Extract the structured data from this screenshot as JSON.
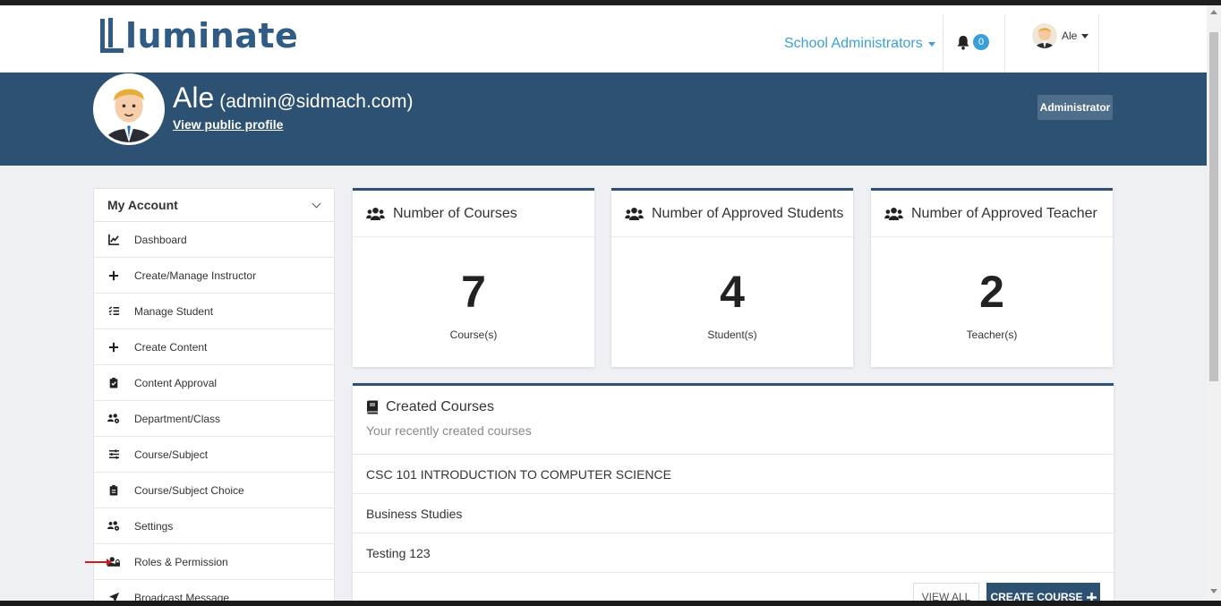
{
  "brand": {
    "name": "luminate"
  },
  "navbar": {
    "role_menu_label": "School Administrators",
    "notification_count": "0",
    "user_name": "Ale"
  },
  "profile": {
    "name": "Ale",
    "email": "(admin@sidmach.com)",
    "public_profile_link": "View public profile",
    "role_badge": "Administrator"
  },
  "sidebar": {
    "title": "My Account",
    "items": [
      {
        "label": "Dashboard",
        "icon": "chart-line-icon"
      },
      {
        "label": "Create/Manage Instructor",
        "icon": "plus-icon"
      },
      {
        "label": "Manage Student",
        "icon": "list-check-icon"
      },
      {
        "label": "Create Content",
        "icon": "plus-icon"
      },
      {
        "label": "Content Approval",
        "icon": "clipboard-check-icon"
      },
      {
        "label": "Department/Class",
        "icon": "users-cog-icon"
      },
      {
        "label": "Course/Subject",
        "icon": "sliders-icon"
      },
      {
        "label": "Course/Subject Choice",
        "icon": "clipboard-list-icon"
      },
      {
        "label": "Settings",
        "icon": "users-cog-icon"
      },
      {
        "label": "Roles & Permission",
        "icon": "user-lock-icon"
      },
      {
        "label": "Broadcast Message",
        "icon": "paper-plane-icon"
      }
    ]
  },
  "stats": [
    {
      "title": "Number of Courses",
      "value": "7",
      "unit": "Course(s)"
    },
    {
      "title": "Number of Approved Students",
      "value": "4",
      "unit": "Student(s)"
    },
    {
      "title": "Number of Approved Teacher",
      "value": "2",
      "unit": "Teacher(s)"
    }
  ],
  "created_courses": {
    "title": "Created Courses",
    "subtitle": "Your recently created courses",
    "rows": [
      "CSC 101 INTRODUCTION TO COMPUTER SCIENCE",
      "Business Studies",
      "Testing 123"
    ],
    "view_all_label": "VIEW ALL",
    "create_label": "CREATE COURSE"
  },
  "colors": {
    "brand_navy": "#2d5172",
    "link_blue": "#3a9fd8",
    "annotation_arrow": "#d0191d"
  }
}
